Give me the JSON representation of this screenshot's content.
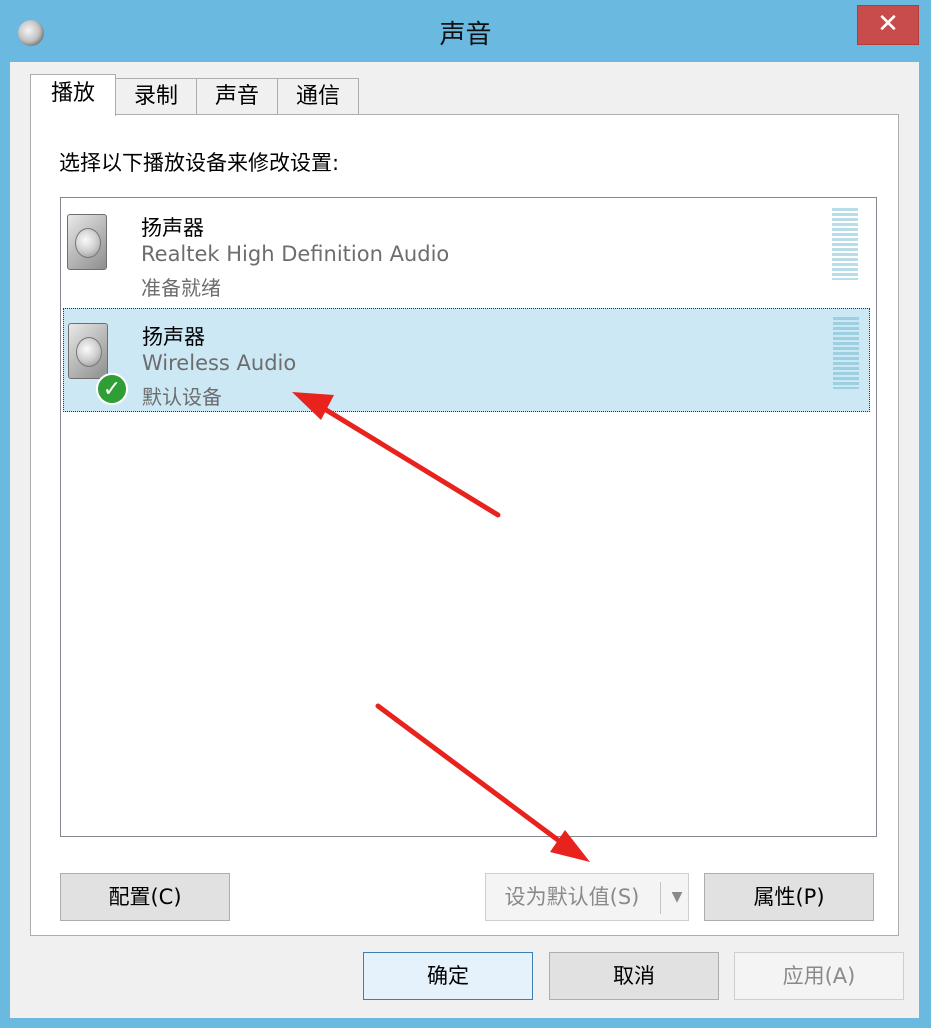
{
  "window": {
    "title": "声音",
    "close_label": "✕"
  },
  "tabs": [
    {
      "label": "播放",
      "active": true
    },
    {
      "label": "录制",
      "active": false
    },
    {
      "label": "声音",
      "active": false
    },
    {
      "label": "通信",
      "active": false
    }
  ],
  "playback": {
    "instruction": "选择以下播放设备来修改设置:",
    "devices": [
      {
        "name": "扬声器",
        "driver": "Realtek High Definition Audio",
        "status": "准备就绪",
        "selected": false,
        "is_default": false
      },
      {
        "name": "扬声器",
        "driver": "Wireless Audio",
        "status": "默认设备",
        "selected": true,
        "is_default": true
      }
    ],
    "configure_label": "配置(C)",
    "set_default_label": "设为默认值(S)",
    "set_default_arrow": "▼",
    "properties_label": "属性(P)"
  },
  "footer": {
    "ok_label": "确定",
    "cancel_label": "取消",
    "apply_label": "应用(A)"
  },
  "colors": {
    "title_bar": "#69b9e0",
    "close_button": "#c84c4c",
    "selection": "#cce8f5",
    "default_badge": "#2f9e35",
    "annotation_arrow": "#e8231e"
  },
  "icons": [
    "speaker-icon",
    "default-check-icon",
    "close-icon",
    "sound-app-icon"
  ]
}
